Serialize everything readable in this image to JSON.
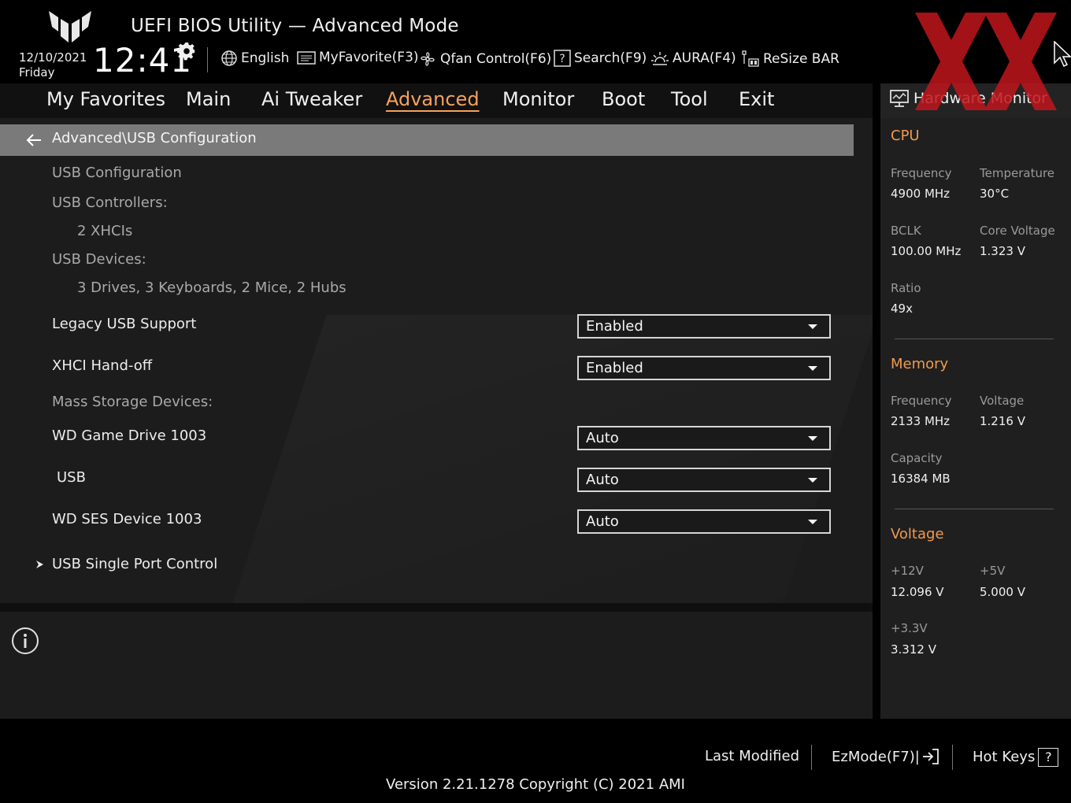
{
  "header": {
    "title": "UEFI BIOS Utility — Advanced Mode",
    "date": "12/10/2021",
    "day": "Friday",
    "time": "12:41",
    "toolbar": [
      {
        "label": "English",
        "icon": "globe-icon"
      },
      {
        "label": "MyFavorite(F3)",
        "icon": "favorite-icon"
      },
      {
        "label": "Qfan Control(F6)",
        "icon": "fan-icon"
      },
      {
        "label": "Search(F9)",
        "icon": "search-help-icon"
      },
      {
        "label": "AURA(F4)",
        "icon": "aura-icon"
      },
      {
        "label": "ReSize BAR",
        "icon": "resize-bar-icon"
      }
    ]
  },
  "tabs": [
    {
      "label": "My Favorites"
    },
    {
      "label": "Main"
    },
    {
      "label": "Ai Tweaker"
    },
    {
      "label": "Advanced",
      "active": true
    },
    {
      "label": "Monitor"
    },
    {
      "label": "Boot"
    },
    {
      "label": "Tool"
    },
    {
      "label": "Exit"
    }
  ],
  "breadcrumb": "Advanced\\USB Configuration",
  "content": {
    "usb_configuration": "USB Configuration",
    "usb_controllers_label": "USB Controllers:",
    "usb_controllers_value": "2 XHCIs",
    "usb_devices_label": "USB Devices:",
    "usb_devices_value": "3 Drives, 3 Keyboards, 2 Mice, 2 Hubs",
    "legacy_usb_label": "Legacy USB Support",
    "legacy_usb_value": "Enabled",
    "xhci_label": "XHCI Hand-off",
    "xhci_value": "Enabled",
    "mass_storage_label": "Mass Storage Devices:",
    "wd_game_label": "WD Game Drive 1003",
    "wd_game_value": "Auto",
    "usb_label": "USB",
    "usb_value": "Auto",
    "wd_ses_label": "WD SES Device 1003",
    "wd_ses_value": "Auto",
    "single_port_label": "USB Single Port Control"
  },
  "hw_monitor": {
    "title": "Hardware Monitor",
    "cpu": {
      "section": "CPU",
      "frequency_label": "Frequency",
      "frequency_value": "4900 MHz",
      "temperature_label": "Temperature",
      "temperature_value": "30°C",
      "bclk_label": "BCLK",
      "bclk_value": "100.00 MHz",
      "core_voltage_label": "Core Voltage",
      "core_voltage_value": "1.323 V",
      "ratio_label": "Ratio",
      "ratio_value": "49x"
    },
    "memory": {
      "section": "Memory",
      "frequency_label": "Frequency",
      "frequency_value": "2133 MHz",
      "voltage_label": "Voltage",
      "voltage_value": "1.216 V",
      "capacity_label": "Capacity",
      "capacity_value": "16384 MB"
    },
    "voltage": {
      "section": "Voltage",
      "v12_label": "+12V",
      "v12_value": "12.096 V",
      "v5_label": "+5V",
      "v5_value": "5.000 V",
      "v33_label": "+3.3V",
      "v33_value": "3.312 V"
    }
  },
  "footer": {
    "last_modified": "Last Modified",
    "ezmode": "EzMode(F7)|",
    "hot_keys": "Hot Keys",
    "hot_keys_key": "?",
    "version": "Version 2.21.1278 Copyright (C) 2021 AMI"
  },
  "colors": {
    "accent": "#f5a25c",
    "section": "#f09a4f",
    "breadcrumb_bg": "#7a7a7a",
    "watermark": "#c0161c"
  }
}
